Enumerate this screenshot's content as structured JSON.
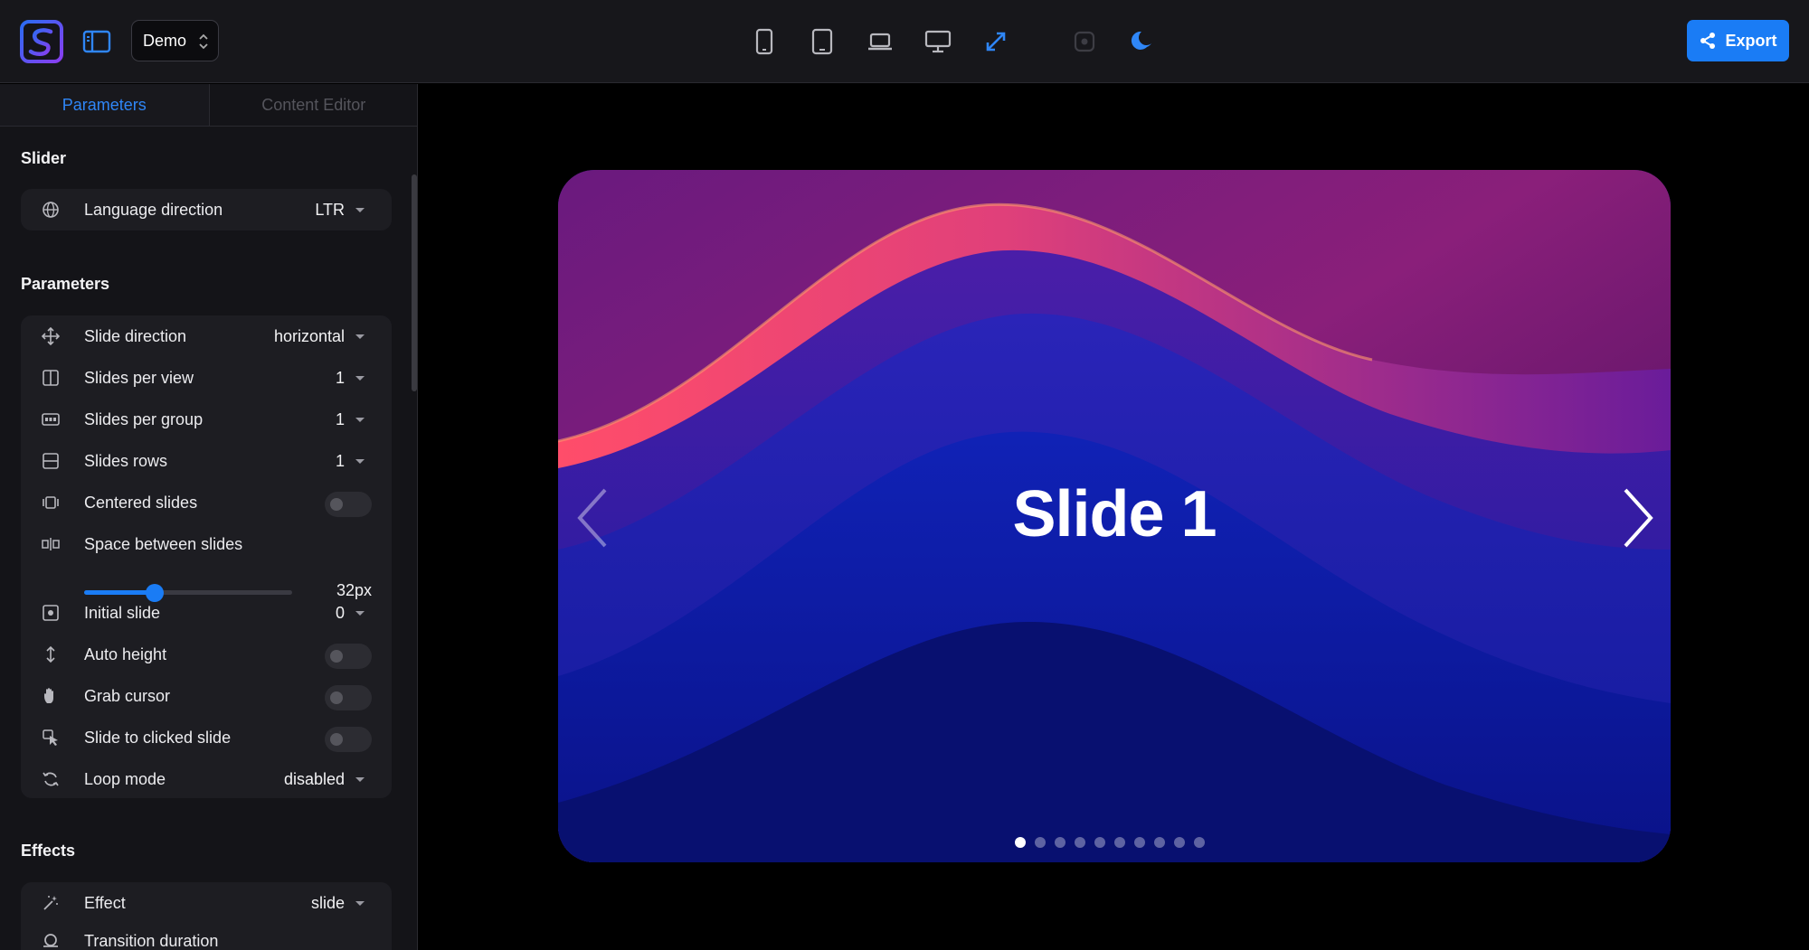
{
  "toolbar": {
    "demo_label": "Demo",
    "export_label": "Export",
    "devices": [
      "phone-icon",
      "tablet-icon",
      "laptop-icon",
      "desktop-icon",
      "expand-icon",
      "record-icon",
      "moon-icon"
    ]
  },
  "tabs": [
    {
      "label": "Parameters",
      "active": true
    },
    {
      "label": "Content Editor",
      "active": false
    }
  ],
  "sections": {
    "slider_title": "Slider",
    "parameters_title": "Parameters",
    "effects_title": "Effects"
  },
  "slider_group": {
    "language_direction": {
      "label": "Language direction",
      "value": "LTR"
    }
  },
  "parameters": {
    "slide_direction": {
      "label": "Slide direction",
      "value": "horizontal"
    },
    "slides_per_view": {
      "label": "Slides per view",
      "value": "1"
    },
    "slides_per_group": {
      "label": "Slides per group",
      "value": "1"
    },
    "slides_rows": {
      "label": "Slides rows",
      "value": "1"
    },
    "centered_slides": {
      "label": "Centered slides",
      "enabled": false
    },
    "space_between": {
      "label": "Space between slides",
      "value": "32px",
      "fraction": 0.34
    },
    "initial_slide": {
      "label": "Initial slide",
      "value": "0"
    },
    "auto_height": {
      "label": "Auto height",
      "enabled": false
    },
    "grab_cursor": {
      "label": "Grab cursor",
      "enabled": false
    },
    "slide_to_clicked": {
      "label": "Slide to clicked slide",
      "enabled": false
    },
    "loop_mode": {
      "label": "Loop mode",
      "value": "disabled"
    }
  },
  "effects": {
    "effect": {
      "label": "Effect",
      "value": "slide"
    },
    "transition_duration": {
      "label": "Transition duration"
    }
  },
  "preview": {
    "slide_title": "Slide 1",
    "dot_count": 10,
    "active_dot": 0
  },
  "colors": {
    "accent": "#1a7cf5",
    "topbar_bg": "#17171b",
    "sidebar_bg": "#141418"
  }
}
